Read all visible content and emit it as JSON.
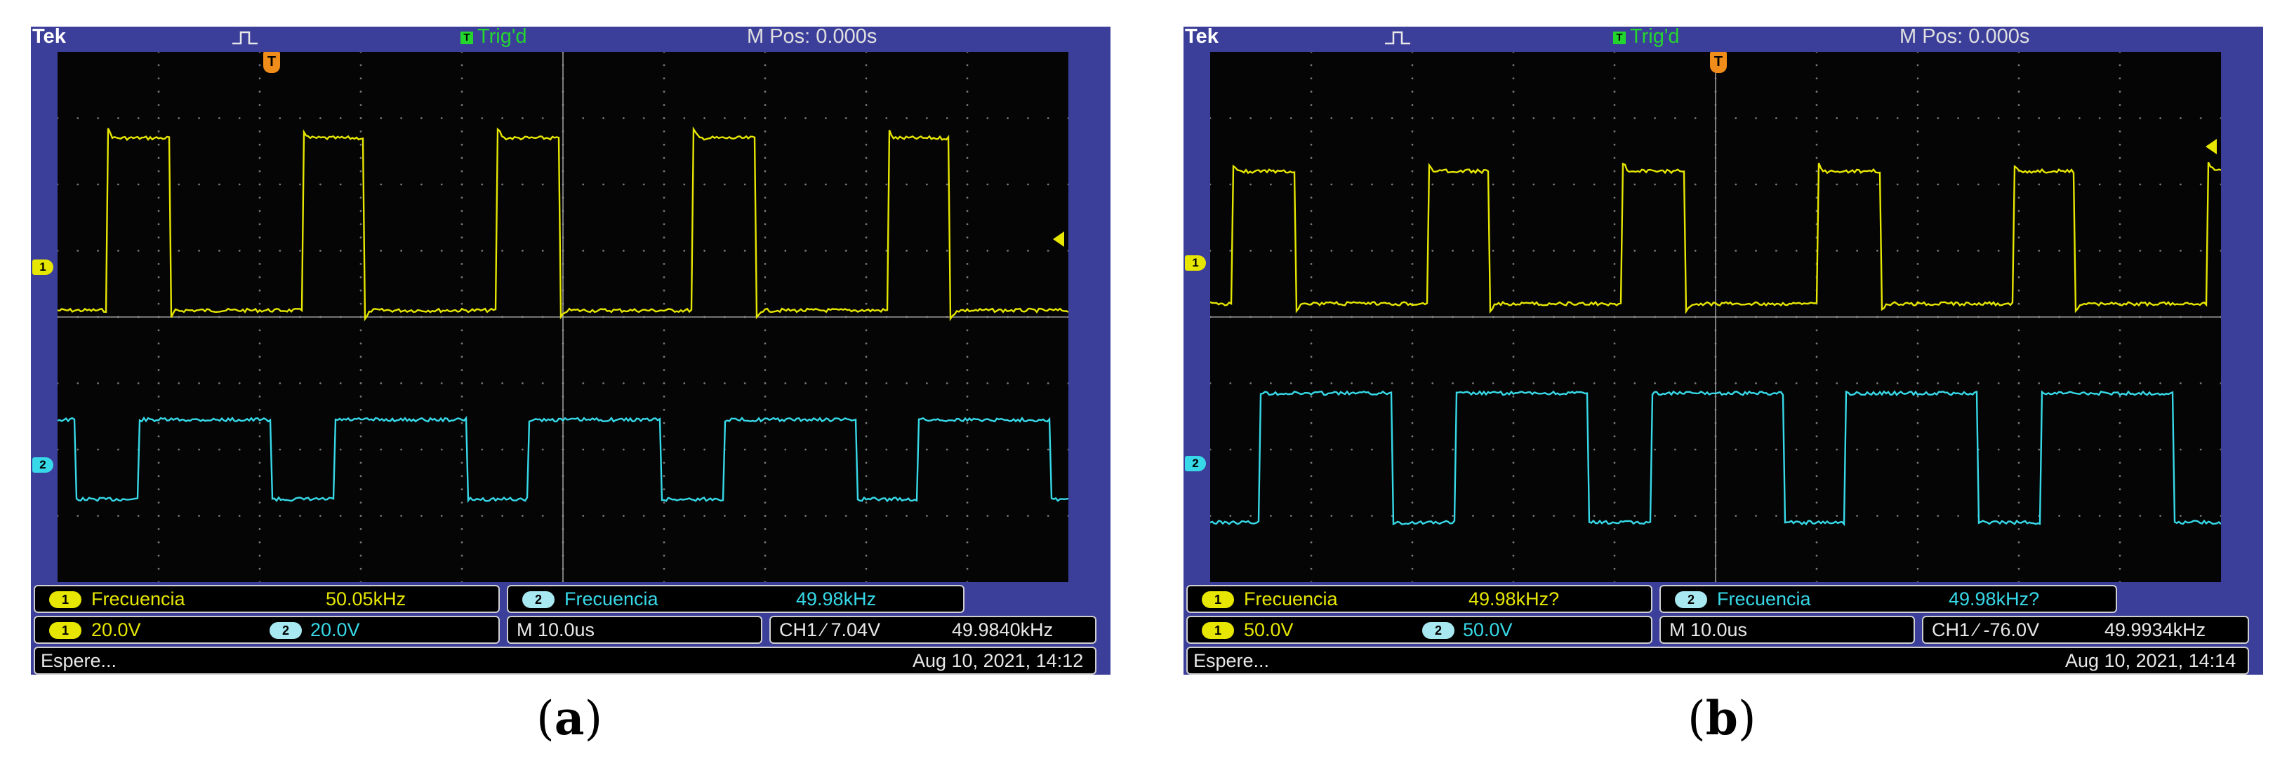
{
  "panels": [
    {
      "tek": "Tek",
      "trig_status": "Trig'd",
      "m_pos": "M Pos: 0.000s",
      "trigger_marker": "T",
      "ch1_marker": "1",
      "ch2_marker": "2",
      "meas1": {
        "channel": "1",
        "label": "Frecuencia",
        "value": "50.05kHz"
      },
      "meas2": {
        "channel": "2",
        "label": "Frecuencia",
        "value": "49.98kHz"
      },
      "ch1_scale": {
        "channel": "1",
        "value": "20.0V"
      },
      "ch2_scale": {
        "channel": "2",
        "value": "20.0V"
      },
      "timebase": "M 10.0us",
      "trigger_readout": "CH1 ⁄ 7.04V",
      "trigger_freq": "49.9840kHz",
      "status": "Espere...",
      "datetime": "Aug 10, 2021, 14:12",
      "caption": "a",
      "ch1_high_level": 3.5,
      "ch1_low_level": 0,
      "ch2_high_level": 2.4,
      "ch2_low_level": -1.2,
      "ch1_duty": 0.32,
      "ch2_duty": 0.32
    },
    {
      "tek": "Tek",
      "trig_status": "Trig'd",
      "m_pos": "M Pos: 0.000s",
      "trigger_marker": "T",
      "ch1_marker": "1",
      "ch2_marker": "2",
      "meas1": {
        "channel": "1",
        "label": "Frecuencia",
        "value": "49.98kHz?"
      },
      "meas2": {
        "channel": "2",
        "label": "Frecuencia",
        "value": "49.98kHz?"
      },
      "ch1_scale": {
        "channel": "1",
        "value": "50.0V"
      },
      "ch2_scale": {
        "channel": "2",
        "value": "50.0V"
      },
      "timebase": "M 10.0us",
      "trigger_readout": "CH1 ⁄ -76.0V",
      "trigger_freq": "49.9934kHz",
      "status": "Espere...",
      "datetime": "Aug 10, 2021, 14:14",
      "caption": "b",
      "ch1_high_level": 2.8,
      "ch1_low_level": 0,
      "ch2_high_level": 2.1,
      "ch2_low_level": 0,
      "ch1_duty": 0.32,
      "ch2_duty": 0.32
    }
  ],
  "colors": {
    "ch1": "#e6e600",
    "ch2": "#37d9e8",
    "frame": "#3c3f9a",
    "trigger": "#f08c1a",
    "trig_status": "#23d62e"
  }
}
